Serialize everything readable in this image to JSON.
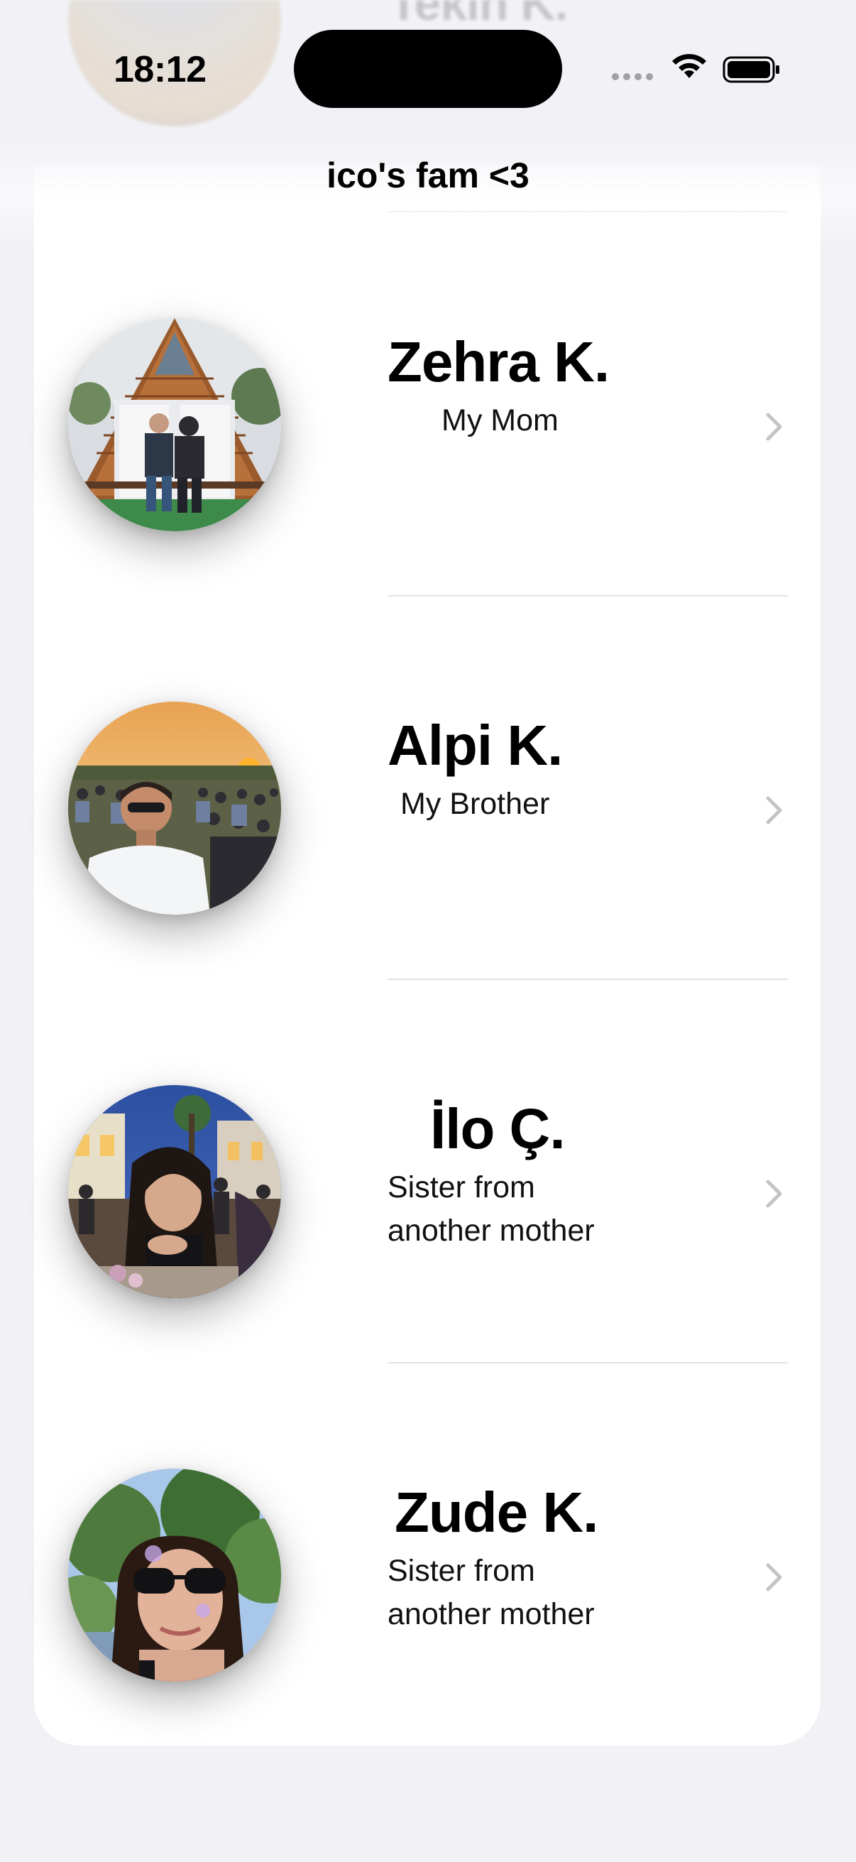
{
  "status_bar": {
    "time": "18:12"
  },
  "nav": {
    "title": "ico's fam <3"
  },
  "ghost_row": {
    "name": "Tekin K."
  },
  "contacts": [
    {
      "name": "Zehra K.",
      "relation": "My Mom",
      "photo_icon": "photo-couple-cabin"
    },
    {
      "name": "Alpi K.",
      "relation": "My Brother",
      "photo_icon": "photo-boy-sunset-crowd"
    },
    {
      "name": "İlo Ç.",
      "relation": "Sister from another mother",
      "photo_icon": "photo-girl-night-street"
    },
    {
      "name": "Zude K.",
      "relation": "Sister from another mother",
      "photo_icon": "photo-girl-sunglasses-trees"
    }
  ],
  "colors": {
    "background": "#f1f1f6",
    "card": "#ffffff",
    "separator": "#e2e2e6",
    "chevron": "#c4c4c7"
  }
}
